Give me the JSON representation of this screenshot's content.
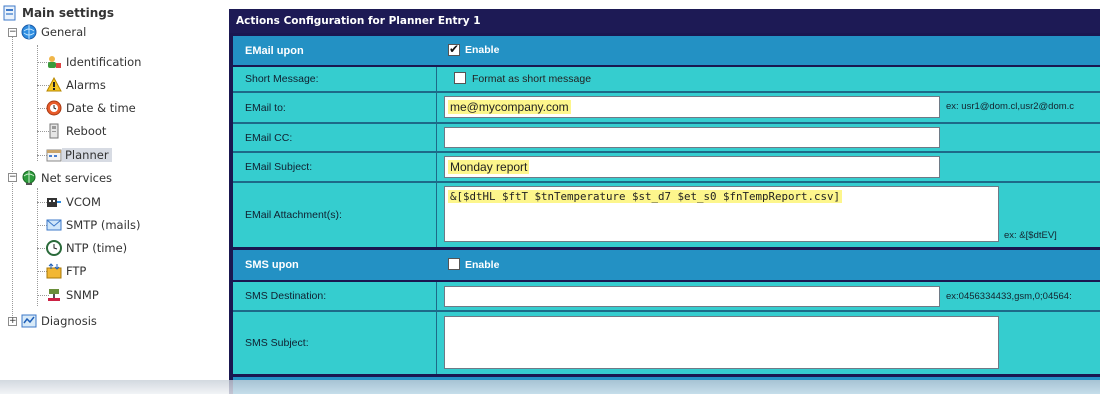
{
  "tree": {
    "root": "Main settings",
    "general": "General",
    "general_items": [
      "Identification",
      "Alarms",
      "Date & time",
      "Reboot",
      "Planner"
    ],
    "net_services": "Net services",
    "net_items": [
      "VCOM",
      "SMTP (mails)",
      "NTP (time)",
      "FTP",
      "SNMP"
    ],
    "diagnosis": "Diagnosis",
    "selected": "Planner"
  },
  "panel": {
    "title": "Actions Configuration for Planner Entry 1",
    "email_section": {
      "header": "EMail upon",
      "enable_label": "Enable",
      "enable_checked": true,
      "short_message_label": "Short Message:",
      "short_message_checkbox_label": "Format as short message",
      "short_message_checked": false,
      "email_to_label": "EMail to:",
      "email_to_value": "me@mycompany.com",
      "email_to_hint": "ex: usr1@dom.cl,usr2@dom.c",
      "email_cc_label": "EMail CC:",
      "email_cc_value": "",
      "email_subject_label": "EMail Subject:",
      "email_subject_value": "Monday report",
      "attachment_label": "EMail Attachment(s):",
      "attachment_value": "&[$dtHL $ftT $tnTemperature $st_d7 $et_s0 $fnTempReport.csv]",
      "attachment_hint": "ex: &[$dtEV]"
    },
    "sms_section": {
      "header": "SMS upon",
      "enable_label": "Enable",
      "enable_checked": false,
      "destination_label": "SMS Destination:",
      "destination_value": "",
      "destination_hint": "ex:0456334433,gsm,0;04564:",
      "subject_label": "SMS Subject:",
      "subject_value": ""
    }
  },
  "colors": {
    "panel_bg": "#1a1750",
    "section_header": "#2391c4",
    "row_bg": "#35cdcf",
    "highlight": "#fdf68c"
  }
}
